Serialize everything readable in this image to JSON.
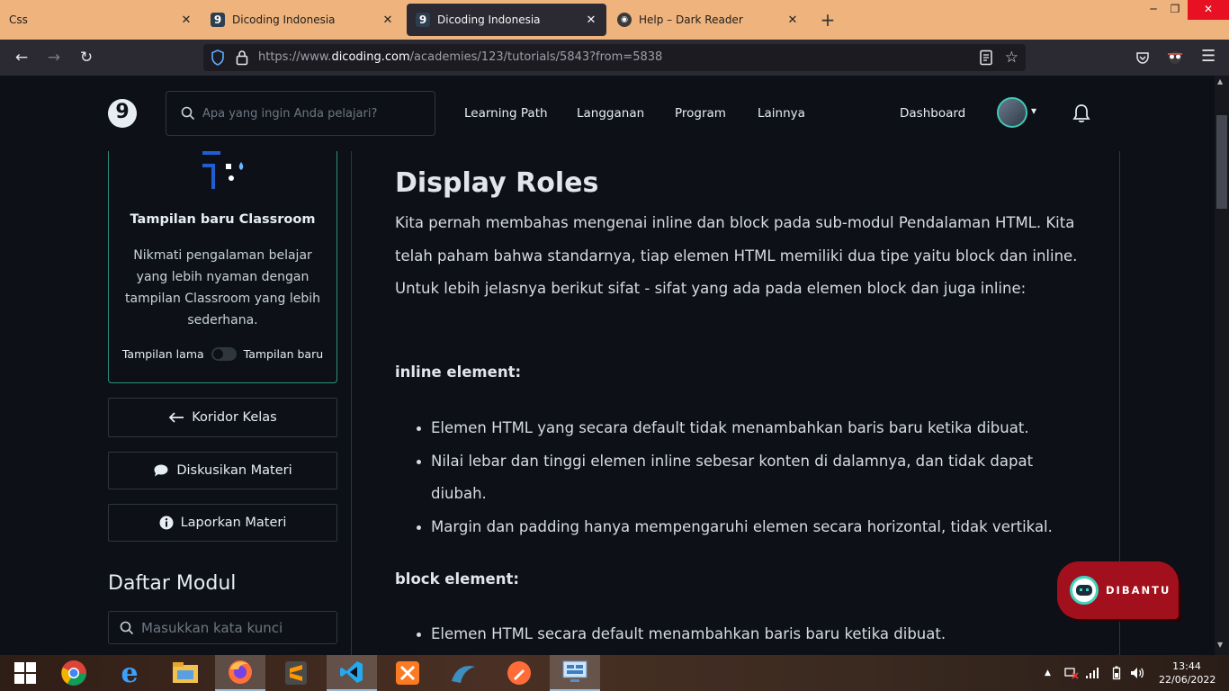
{
  "browser": {
    "tabs": [
      {
        "title": "Css",
        "active": false
      },
      {
        "title": "Dicoding Indonesia",
        "active": false
      },
      {
        "title": "Dicoding Indonesia",
        "active": true
      },
      {
        "title": "Help – Dark Reader",
        "active": false
      }
    ],
    "url_prefix": "https://www.",
    "url_domain": "dicoding.com",
    "url_path": "/academies/123/tutorials/5843?from=5838"
  },
  "header": {
    "logo": "9",
    "search_placeholder": "Apa yang ingin Anda pelajari?",
    "menu": [
      "Learning Path",
      "Langganan",
      "Program",
      "Lainnya"
    ],
    "dashboard": "Dashboard"
  },
  "sidebar": {
    "card_title": "Tampilan baru Classroom",
    "card_text": "Nikmati pengalaman belajar yang lebih nyaman dengan tampilan Classroom yang lebih sederhana.",
    "toggle_left": "Tampilan lama",
    "toggle_right": "Tampilan baru",
    "toggle_on": false,
    "buttons": [
      "Koridor Kelas",
      "Diskusikan Materi",
      "Laporkan Materi"
    ],
    "modul_title": "Daftar Modul",
    "modul_search_placeholder": "Masukkan kata kunci"
  },
  "article": {
    "title": "Display Roles",
    "intro": "Kita pernah membahas mengenai inline dan block pada sub-modul Pendalaman HTML. Kita telah paham bahwa standarnya, tiap elemen HTML memiliki dua tipe yaitu block dan inline. Untuk lebih jelasnya berikut sifat - sifat yang ada pada elemen block dan juga inline:",
    "inline_heading": "inline element:",
    "inline_items": [
      "Elemen HTML yang secara default tidak menambahkan baris baru ketika dibuat.",
      "Nilai lebar dan tinggi elemen inline sebesar konten di dalamnya, dan tidak dapat diubah.",
      "Margin dan padding hanya mempengaruhi elemen secara horizontal, tidak vertikal."
    ],
    "block_heading": "block element:",
    "block_items": [
      "Elemen HTML secara default menambahkan baris baru ketika dibuat."
    ]
  },
  "dibantu": {
    "label": "DIBANTU"
  },
  "taskbar": {
    "time": "13:44",
    "date": "22/06/2022",
    "apps": [
      "windows-start",
      "chrome",
      "internet-explorer",
      "file-explorer",
      "firefox",
      "sublime-text",
      "vscode",
      "xampp",
      "mysql-workbench",
      "postman",
      "control-panel"
    ]
  }
}
